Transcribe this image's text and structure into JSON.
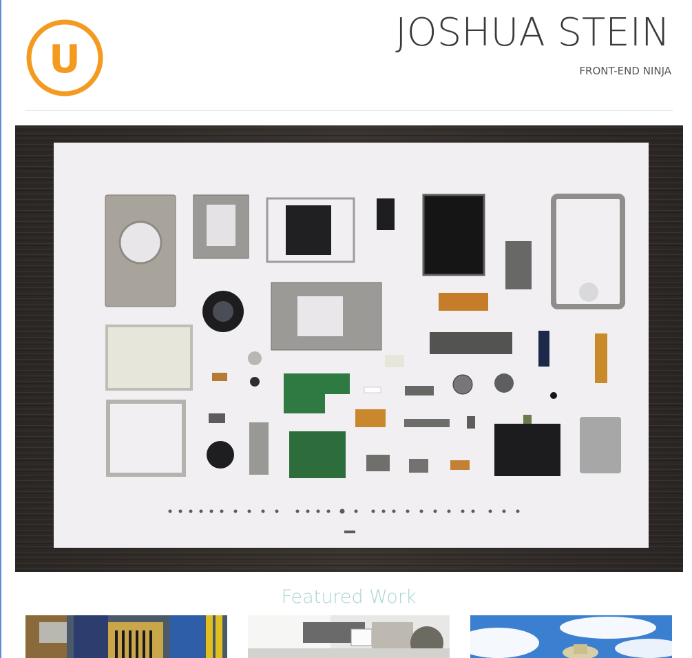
{
  "header": {
    "logo_letter": "U",
    "logo_color": "#f39a1f",
    "title": "JOSHUA STEIN",
    "tagline": "FRONT-END NINJA"
  },
  "hero": {
    "description": "disassembled camera parts laid out on white paper over a dark wood table"
  },
  "featured": {
    "heading": "Featured Work",
    "items": [
      {
        "thumb": "circuit-board-photo"
      },
      {
        "thumb": "desk-computer-photo"
      },
      {
        "thumb": "sky-hat-photo"
      }
    ]
  },
  "colors": {
    "accent_orange": "#f39a1f",
    "heading_teal": "#a9d6d2",
    "title_gray": "#3a3a3a",
    "wood": "#2e2a28",
    "paper": "#f2f0f2"
  }
}
